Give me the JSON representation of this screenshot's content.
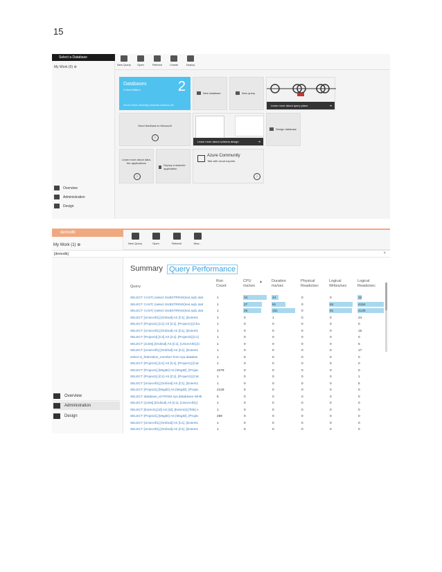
{
  "page_number": "15",
  "shot1": {
    "title": "Select a Database",
    "my_work": "My Work (0) ⊕",
    "ribbon": [
      "New Query",
      "Open",
      "Refresh",
      "Create",
      "Deploy"
    ],
    "nav": [
      "Overview",
      "Administration",
      "Design"
    ],
    "tiles": {
      "databases_title": "Databases",
      "databases_sub": "2 New Edition",
      "databases_count": "2",
      "databases_footer": "Server Name: abcdefgh.database.windows.net",
      "new_database": "New database",
      "new_query": "New query",
      "learn_query_plans": "Learn more about query plans",
      "send_feedback": "Send feedback to Microsoft",
      "learn_schema": "Learn more about schema design",
      "design_database": "Design database",
      "learn_data_tier": "Learn more about data-tier applications",
      "deploy_data_tier": "Deploy a data-tier application",
      "azure_title": "Azure Community",
      "azure_sub": "Talk with cloud experts"
    }
  },
  "shot2": {
    "tab": "demodb",
    "my_work": "My Work (1) ⊕",
    "db_label": "[demodb]",
    "close": "×",
    "ribbon": [
      "New Query",
      "Open",
      "Refresh",
      "New..."
    ],
    "nav": [
      "Overview",
      "Administration",
      "Design"
    ],
    "tabs": {
      "summary": "Summary",
      "query_performance": "Query Performance"
    },
    "headers": [
      "Query",
      "Run Count",
      "CPU ms/sec",
      "Duration ms/sec",
      "Physical Reads/sec",
      "Logical Writes/sec",
      "Logical Reads/sec"
    ],
    "rows": [
      [
        "SELECT CAST( (select SUBSTRING(text,sql1.stat",
        "1",
        "34",
        "44",
        "0",
        "0",
        "32"
      ],
      [
        "SELECT CAST( (select SUBSTRING(text,sql1.stat",
        "1",
        "27",
        "91",
        "0",
        "84",
        "4154"
      ],
      [
        "SELECT CAST( (select SUBSTRING(text,sql1.stat",
        "1",
        "26",
        "151",
        "0",
        "81",
        "4130"
      ],
      [
        "SELECT [UnionAll1].[Ordinal] AS [C1], [Extent1",
        "1",
        "0",
        "1",
        "0",
        "0",
        "24"
      ],
      [
        "SELECT [Project1].[C1] AS [C1], [Project1].[Cha",
        "1",
        "0",
        "0",
        "0",
        "0",
        "0"
      ],
      [
        "SELECT [UnionAll1].[Ordinal] AS [C1], [Extent1",
        "1",
        "0",
        "0",
        "0",
        "0",
        "15"
      ],
      [
        "SELECT [Project3].[C4] AS [C1], [Project3].[C1]",
        "1",
        "0",
        "0",
        "0",
        "0",
        "0"
      ],
      [
        "SELECT [Join5].[Ordinal] AS [C1], [UnionAll4].[C",
        "1",
        "0",
        "0",
        "0",
        "0",
        "5"
      ],
      [
        "SELECT [UnionAll1].[Ordinal] AS [C1], [Extent1",
        "1",
        "0",
        "0",
        "0",
        "0",
        "17"
      ],
      [
        "select is_federation_member from sys.databas",
        "1",
        "0",
        "0",
        "0",
        "0",
        "0"
      ],
      [
        "SELECT [Project1].[C1] AS [C1], [Project1].[Cat",
        "1",
        "0",
        "0",
        "0",
        "0",
        "0"
      ],
      [
        "SELECT [Project1].[MsgID] AS [MsgID], [Projec",
        "2279",
        "0",
        "0",
        "0",
        "0",
        "0"
      ],
      [
        "SELECT [Project1].[C1] AS [C1], [Project1].[Cat",
        "1",
        "0",
        "0",
        "0",
        "0",
        "1"
      ],
      [
        "SELECT [UnionAll1].[Ordinal] AS [C1], [Extent1",
        "1",
        "0",
        "0",
        "0",
        "0",
        "5"
      ],
      [
        "SELECT [Project1].[MsgID] AS [MsgID], [Projec",
        "2129",
        "0",
        "0",
        "0",
        "0",
        "0"
      ],
      [
        "SELECT database_id FROM sys.databases WHE",
        "5",
        "0",
        "0",
        "0",
        "0",
        "0"
      ],
      [
        "SELECT [Join5].[Ordinal] AS [C1], [UnionAll4].[",
        "1",
        "0",
        "0",
        "0",
        "0",
        "0"
      ],
      [
        "SELECT [Extent1].[Id] AS [Id], [Extent1].[Title] A",
        "1",
        "0",
        "0",
        "0",
        "0",
        "0"
      ],
      [
        "SELECT [Project1].[MsgID] AS [MsgID], [Projec",
        "259",
        "0",
        "0",
        "0",
        "0",
        "0"
      ],
      [
        "SELECT [UnionAll1].[Ordinal] AS [C1], [Extent1",
        "1",
        "0",
        "0",
        "0",
        "0",
        "0"
      ],
      [
        "SELECT [UnionAll1].[Ordinal] AS [C1], [Extent1",
        "1",
        "0",
        "0",
        "0",
        "0",
        "0"
      ]
    ],
    "bars": {
      "cpu": [
        34,
        27,
        26
      ],
      "duration": [
        44,
        91,
        151
      ],
      "logical_writes": [
        0,
        84,
        81
      ],
      "logical_reads": [
        32,
        4154,
        4130
      ]
    },
    "colors": {
      "bar": "#a9d8ee",
      "accent_tab": "#f0a880",
      "link": "#3a7cc0"
    }
  }
}
